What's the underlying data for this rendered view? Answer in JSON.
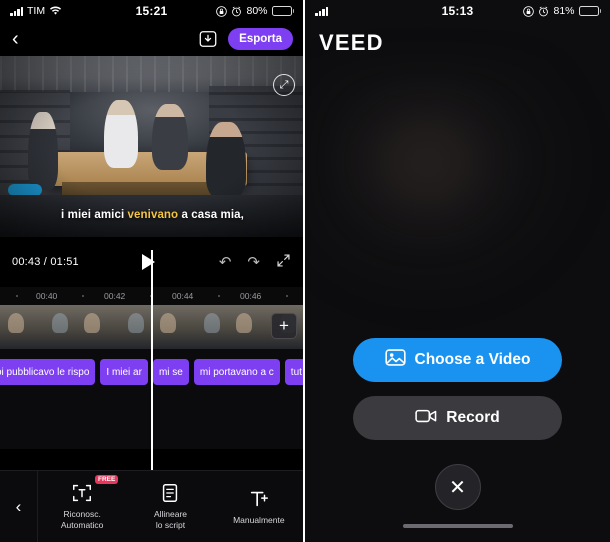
{
  "left": {
    "status": {
      "carrier": "TIM",
      "time": "15:21",
      "battery_pct": "80%",
      "icons": [
        "signal-icon",
        "wifi-icon",
        "lock-rotation-icon",
        "alarm-icon",
        "battery-icon"
      ]
    },
    "header": {
      "back": "‹",
      "download_icon": "download-icon",
      "export_label": "Esporta"
    },
    "preview": {
      "caption_pre": "i miei amici ",
      "caption_highlight": "venivano",
      "caption_post": " a casa mia,",
      "corner_button": "⤢"
    },
    "transport": {
      "current_time": "00:43",
      "separator": " / ",
      "total_time": "01:51",
      "play": "play-icon",
      "undo": "↶",
      "redo": "↷",
      "fullscreen": "⤡"
    },
    "ruler": {
      "ticks": [
        "00:40",
        "00:42",
        "00:44",
        "00:46"
      ]
    },
    "timeline": {
      "add_label": "+",
      "subtitles": [
        "oi pubblicavo le rispo",
        "I miei ar",
        "mi se",
        "mi portavano a c",
        "tut"
      ]
    },
    "toolbar": {
      "back": "‹",
      "items": [
        {
          "label": "Riconosc.\nAutomatico",
          "icon": "auto-recognize-icon",
          "badge": "FREE"
        },
        {
          "label": "Allineare\nlo script",
          "icon": "align-script-icon",
          "badge": ""
        },
        {
          "label": "Manualmente",
          "icon": "manual-text-icon",
          "badge": ""
        }
      ]
    }
  },
  "right": {
    "status": {
      "carrier": "",
      "time": "15:13",
      "battery_pct": "81%",
      "icons": [
        "lock-rotation-icon",
        "alarm-icon",
        "battery-icon"
      ]
    },
    "logo": "VEED",
    "buttons": [
      {
        "label": "Choose a Video",
        "icon": "photo-icon",
        "style": "primary"
      },
      {
        "label": "Record",
        "icon": "video-camera-icon",
        "style": "secondary"
      }
    ],
    "close": "✕"
  },
  "colors": {
    "accent_purple": "#7e3ff2",
    "accent_blue": "#1a93f0",
    "badge_red": "#e8365d",
    "caption_highlight": "#f5c542"
  }
}
